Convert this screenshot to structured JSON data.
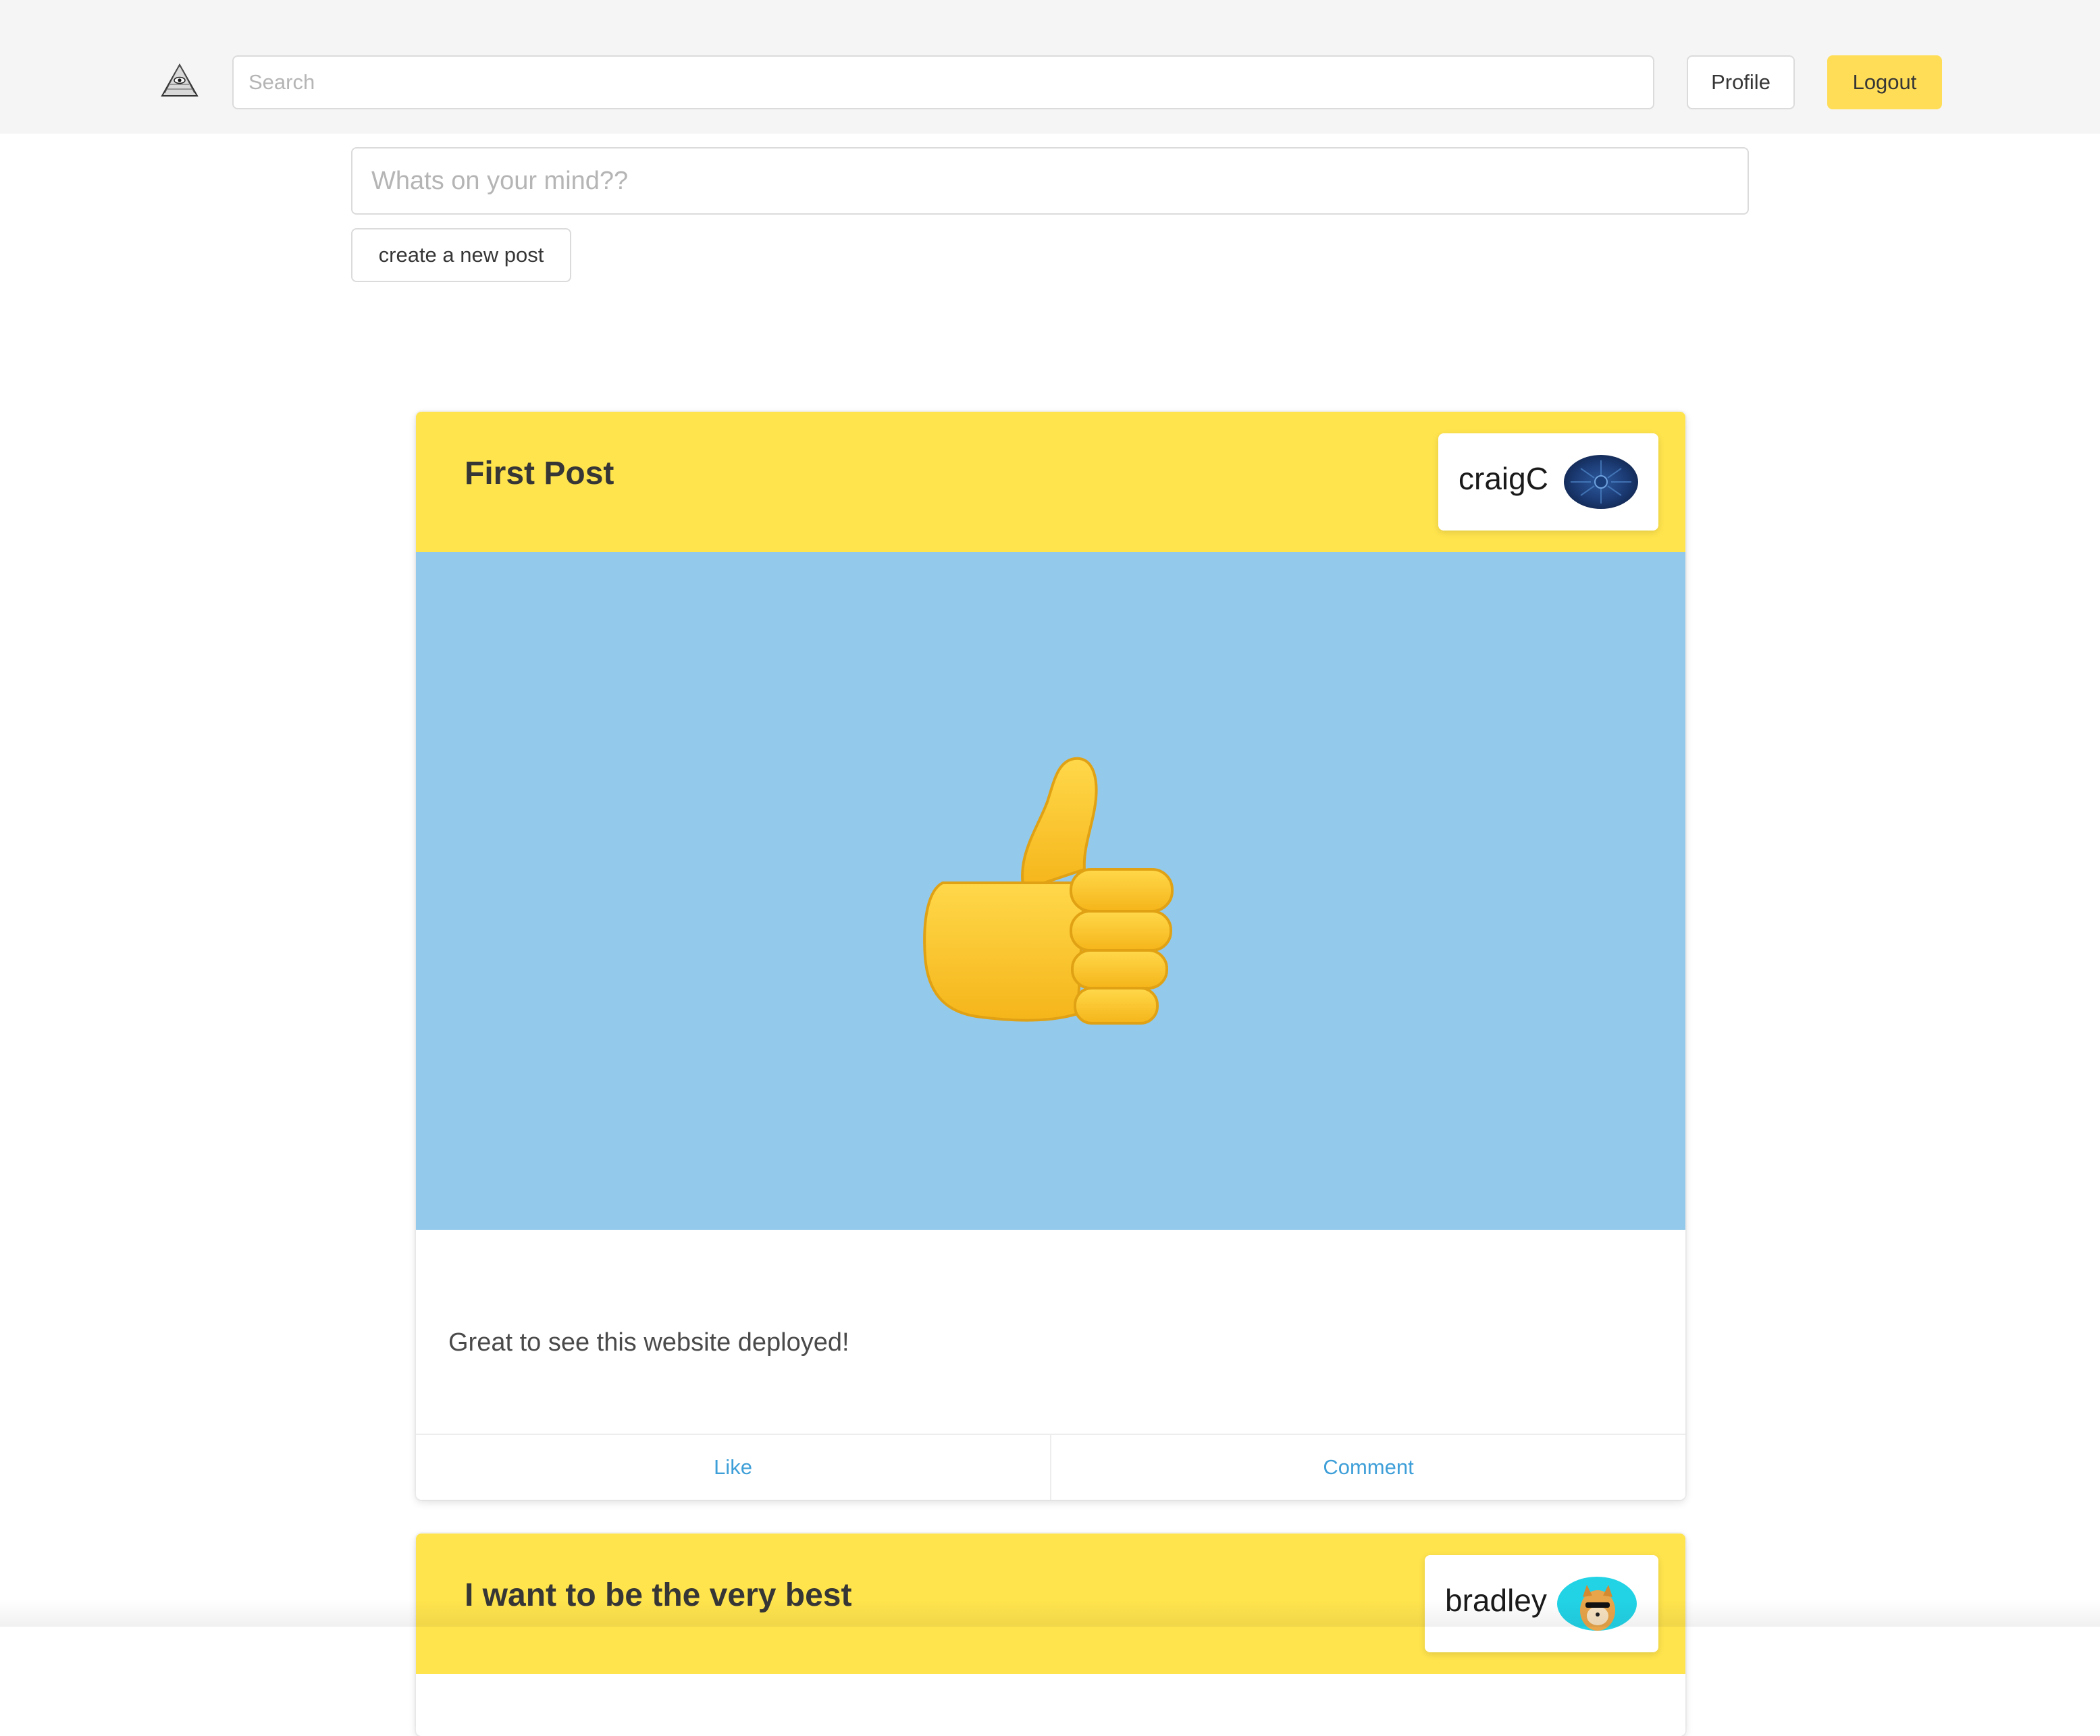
{
  "nav": {
    "logo_icon": "eye-pyramid-icon",
    "search_placeholder": "Search",
    "search_value": "",
    "profile_label": "Profile",
    "logout_label": "Logout",
    "accent_color": "#ffdd57"
  },
  "composer": {
    "placeholder": "Whats on your mind??",
    "value": "",
    "create_label": "create a new post"
  },
  "posts": [
    {
      "title": "First Post",
      "author": "craigC",
      "avatar_icon": "dark-blue-circuit-avatar",
      "image_icon": "thumbs-up-emoji",
      "content": "Great to see this website deployed!",
      "like_label": "Like",
      "comment_label": "Comment"
    },
    {
      "title": "I want to be the very best",
      "author": "bradley",
      "avatar_icon": "doge-avatar"
    }
  ],
  "colors": {
    "header_yellow": "#ffe44d",
    "image_bg": "#93c9ea",
    "link_blue": "#3e9fd8"
  }
}
